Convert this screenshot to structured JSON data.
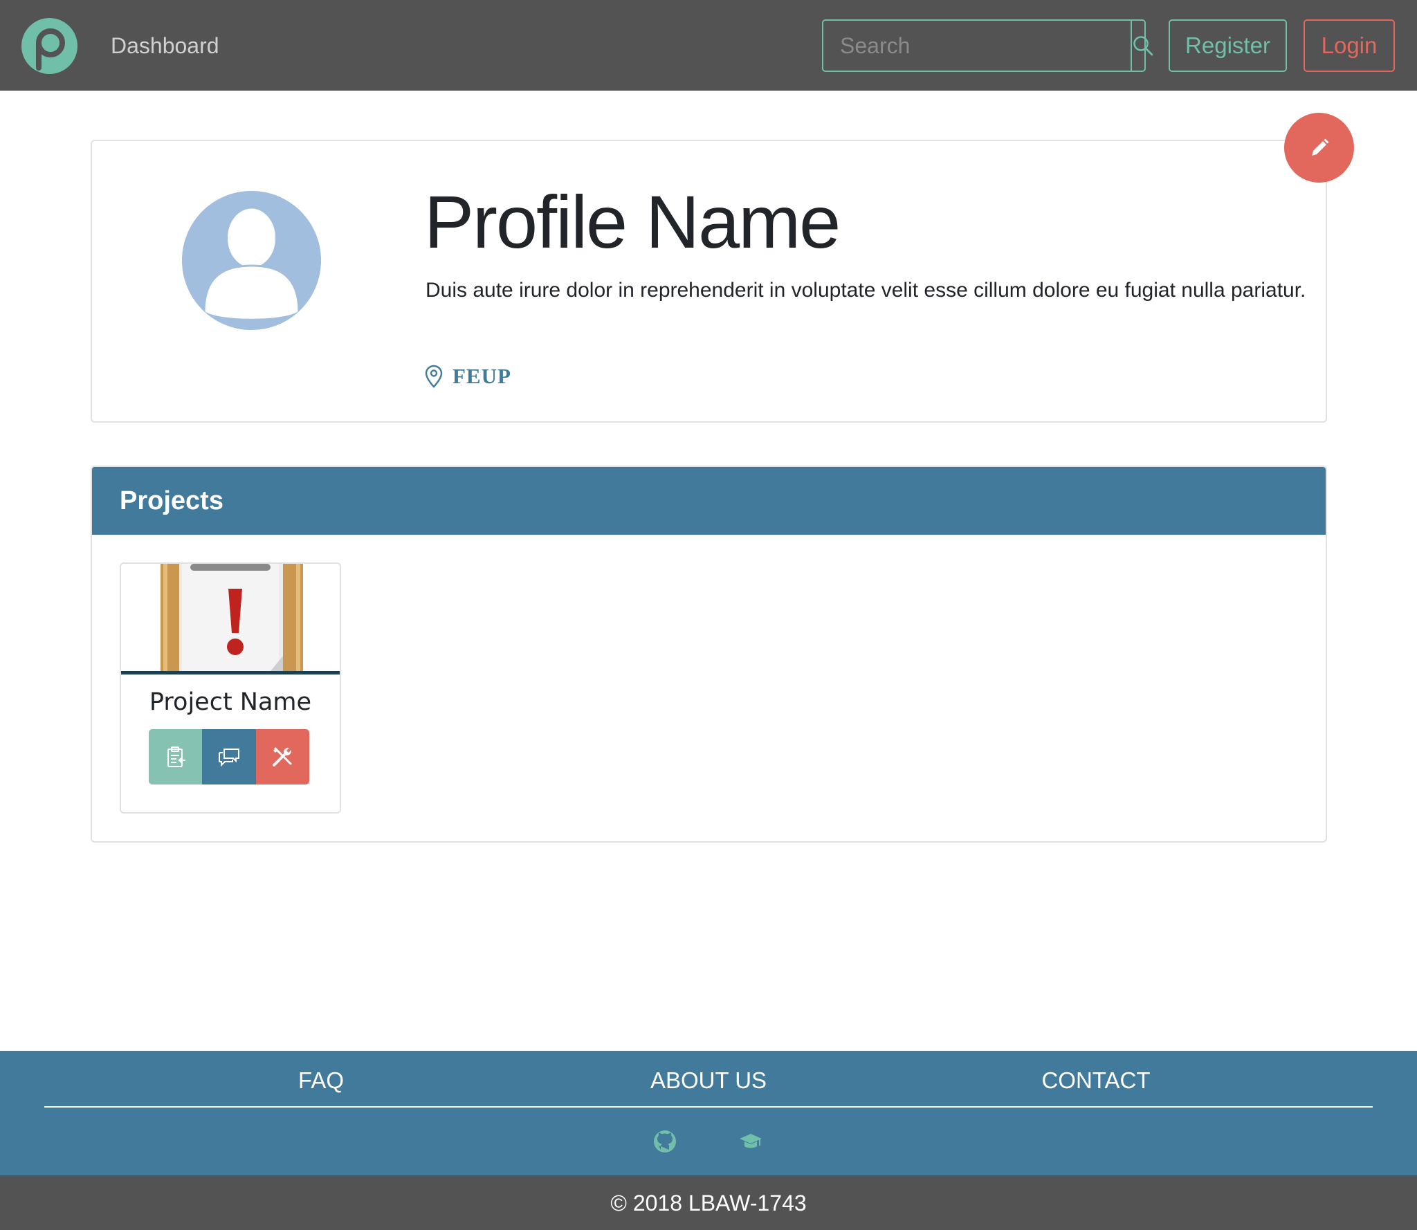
{
  "navbar": {
    "logo_icon": "app-logo-icon",
    "dashboard_label": "Dashboard",
    "search": {
      "placeholder": "Search",
      "value": "",
      "icon": "search-icon"
    },
    "register_label": "Register",
    "login_label": "Login"
  },
  "profile": {
    "name": "Profile Name",
    "bio": "Duis aute irure dolor in reprehenderit in voluptate velit esse cillum dolore eu fugiat nulla pariatur.",
    "location": "FEUP",
    "location_icon": "map-pin-icon",
    "avatar_icon": "user-avatar-icon",
    "edit_icon": "pencil-icon"
  },
  "projects": {
    "title": "Projects",
    "items": [
      {
        "name": "Project Name",
        "thumbnail_icon": "clipboard-alert-icon",
        "actions": [
          {
            "icon": "clipboard-enter-icon",
            "color": "#86c2b1"
          },
          {
            "icon": "chat-bubbles-icon",
            "color": "#417a9b"
          },
          {
            "icon": "tools-icon",
            "color": "#e2675d"
          }
        ]
      }
    ]
  },
  "footer": {
    "links": [
      "FAQ",
      "ABOUT US",
      "CONTACT"
    ],
    "icons": [
      "github-icon",
      "graduation-cap-icon"
    ],
    "copyright": "© 2018 LBAW-1743"
  },
  "colors": {
    "navbar_bg": "#535353",
    "primary_blue": "#417a9b",
    "accent_green": "#6fbfa9",
    "accent_red": "#e2675d",
    "avatar_bg": "#a2bede"
  }
}
